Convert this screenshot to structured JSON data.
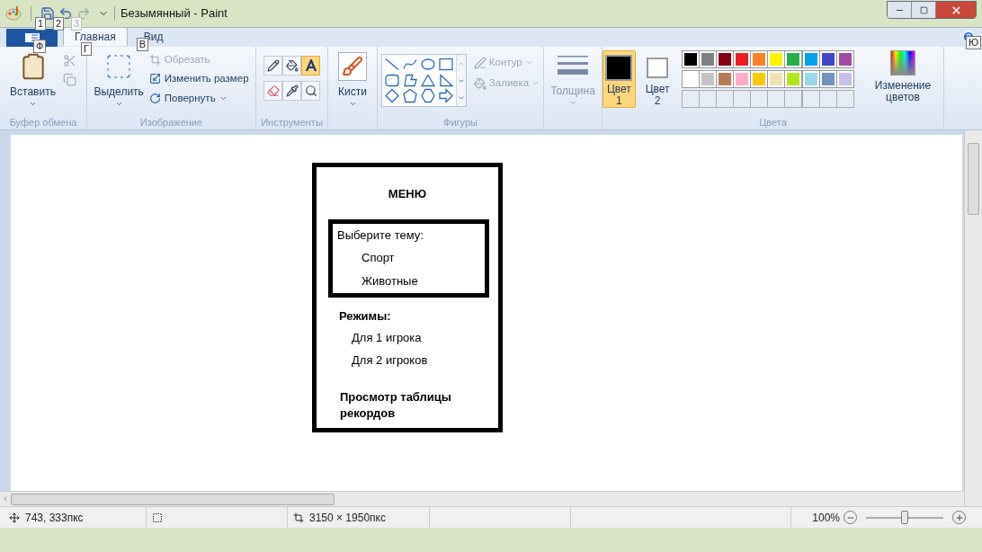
{
  "window": {
    "title": "Безымянный - Paint"
  },
  "quick_access": [
    {
      "kind": "save",
      "keytip": "1",
      "disabled": false
    },
    {
      "kind": "undo",
      "keytip": "2",
      "disabled": false
    },
    {
      "kind": "redo",
      "keytip": "3",
      "disabled": true
    }
  ],
  "tabs": [
    {
      "kind": "file",
      "keytip": "Ф",
      "selected": false
    },
    {
      "kind": "tab",
      "label": "Главная",
      "keytip": "Г",
      "selected": true
    },
    {
      "kind": "tab",
      "label": "Вид",
      "keytip": "В",
      "selected": false
    }
  ],
  "help_keytip": "Ю",
  "clipboard": {
    "paste": "Вставить",
    "group": "Буфер обмена"
  },
  "image": {
    "select": "Выделить",
    "crop": "Обрезать",
    "crop_disabled": true,
    "resize": "Изменить размер",
    "rotate": "Повернуть",
    "group": "Изображение"
  },
  "tools": {
    "group": "Инструменты",
    "items": [
      {
        "kind": "pencil",
        "selected": false
      },
      {
        "kind": "fill",
        "selected": false
      },
      {
        "kind": "text",
        "selected": true
      },
      {
        "kind": "eraser",
        "selected": false
      },
      {
        "kind": "picker",
        "selected": false
      },
      {
        "kind": "magnifier",
        "selected": false
      }
    ]
  },
  "brushes": {
    "label": "Кисти"
  },
  "shapes": {
    "group": "Фигуры",
    "outline": "Контур",
    "outline_disabled": true,
    "fill": "Заливка",
    "fill_disabled": true
  },
  "size": {
    "label": "Толщина",
    "disabled": true
  },
  "colors": {
    "group": "Цвета",
    "edit": "Изменение цветов",
    "slots": [
      {
        "label": "Цвет",
        "number": "1",
        "color": "#000000",
        "selected": true
      },
      {
        "label": "Цвет",
        "number": "2",
        "color": "#ffffff",
        "selected": false
      }
    ],
    "palette": [
      {
        "color": "#000000"
      },
      {
        "color": "#7f7f7f"
      },
      {
        "color": "#880015"
      },
      {
        "color": "#ed1c24"
      },
      {
        "color": "#ff7f27"
      },
      {
        "color": "#fff200"
      },
      {
        "color": "#22b14c"
      },
      {
        "color": "#00a2e8"
      },
      {
        "color": "#3f48cc"
      },
      {
        "color": "#a349a4"
      },
      {
        "color": "#ffffff"
      },
      {
        "color": "#c3c3c3"
      },
      {
        "color": "#b97a57"
      },
      {
        "color": "#ffaec9"
      },
      {
        "color": "#ffc90e"
      },
      {
        "color": "#efe4b0"
      },
      {
        "color": "#b5e61d"
      },
      {
        "color": "#99d9ea"
      },
      {
        "color": "#7092be"
      },
      {
        "color": "#c8bfe7"
      }
    ]
  },
  "canvas": {
    "title": "МЕНЮ",
    "topic": {
      "prompt": "Выберите тему:",
      "options": [
        "Спорт",
        "Животные"
      ]
    },
    "modes": {
      "heading": "Режимы:",
      "options": [
        "Для 1 игрока",
        "Для 2 игроков"
      ]
    },
    "records": "Просмотр таблицы рекордов"
  },
  "status_bar": {
    "position": "743, 333пкс",
    "size": "3150 × 1950пкс",
    "zoom": "100%",
    "zoom_slider": {
      "level": 0.5
    }
  }
}
